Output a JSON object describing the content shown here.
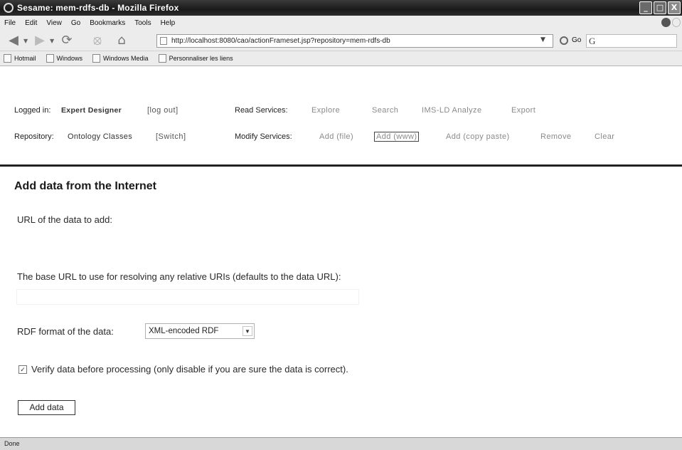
{
  "window": {
    "title": "Sesame: mem-rdfs-db - Mozilla Firefox",
    "buttons": {
      "minimize": "_",
      "maximize": "□",
      "close": "X"
    }
  },
  "menu": [
    "File",
    "Edit",
    "View",
    "Go",
    "Bookmarks",
    "Tools",
    "Help"
  ],
  "toolbar": {
    "back_icon": "back-arrow-icon",
    "forward_icon": "forward-arrow-icon",
    "url": "http://localhost:8080/cao/actionFrameset.jsp?repository=mem-rdfs-db",
    "go_label": "Go",
    "search_text": "G"
  },
  "bookmarks": [
    "Hotmail",
    "Windows",
    "Windows Media",
    "Personnaliser les liens"
  ],
  "sesame": {
    "logged_in_label": "Logged in:",
    "user": "Expert Designer",
    "logout": "[log out]",
    "read_services_label": "Read Services:",
    "read_services": [
      "Explore",
      "Search",
      "IMS-LD Analyze",
      "Export"
    ],
    "repository_label": "Repository:",
    "repository": "Ontology Classes",
    "switch": "[Switch]",
    "modify_services_label": "Modify Services:",
    "modify_services": [
      "Add (file)",
      "Add (www)",
      "Add (copy paste)",
      "Remove",
      "Clear"
    ],
    "active_modify_service_index": 1
  },
  "form": {
    "title": "Add data from the Internet",
    "url_label": "URL of the data to add:",
    "url_value": "",
    "base_label": "The base URL to use for resolving any relative URIs (defaults to the data URL):",
    "base_value": "",
    "format_label": "RDF format of the data:",
    "format_value": "XML-encoded RDF",
    "verify_label": "Verify data before processing (only disable if you are sure the data is correct).",
    "verify_checked": true,
    "verify_mark": "✓",
    "submit_label": "Add data"
  },
  "status": "Done"
}
